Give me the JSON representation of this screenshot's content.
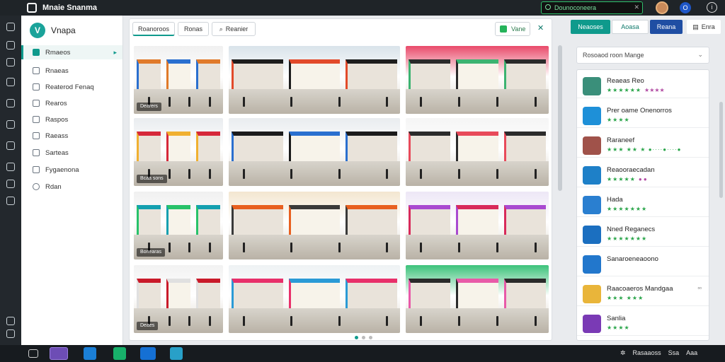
{
  "window": {
    "title": "Mnaie Snanma"
  },
  "titlebar": {
    "search_text": "Dounoconeera",
    "account_letter": "O",
    "info_glyph": "i"
  },
  "sidebar": {
    "brand": "Vnapa",
    "items": [
      {
        "label": "Rmaeos",
        "active": true
      },
      {
        "label": "Rnaeas"
      },
      {
        "label": "Reaterod Fenaq"
      },
      {
        "label": "Rearos"
      },
      {
        "label": "Raspos"
      },
      {
        "label": "Raeass"
      },
      {
        "label": "Sarteas"
      },
      {
        "label": "Fygaenona"
      },
      {
        "label": "Rdan"
      }
    ]
  },
  "main": {
    "tabs": [
      {
        "label": "Roanoroos",
        "active": true
      },
      {
        "label": "Ronas"
      },
      {
        "label": "Reanier"
      }
    ],
    "action_label": "Vane",
    "tile_captions": [
      "Dearers",
      "Bcaa sons",
      "Bonearas",
      "Deaes"
    ]
  },
  "right": {
    "tabs": [
      {
        "label": "Neaoses",
        "bg": "#0f9a8c",
        "color": "#ffffff"
      },
      {
        "label": "Aoasa",
        "bg": "#ffffff",
        "color": "#0f7a6c"
      },
      {
        "label": "Reana",
        "bg": "#1f4ea3",
        "color": "#ffffff"
      },
      {
        "label": "Enra",
        "bg": "#ffffff",
        "color": "#333333"
      }
    ],
    "dropdown": "Rosoaod roon Mange",
    "list": [
      {
        "name": "Reaeas Reo",
        "stars": "★★★★★★",
        "meta": "★★★★",
        "thumb": "#3a8f7a"
      },
      {
        "name": "Prer oame Onenorros",
        "stars": "★★★★",
        "meta": "",
        "thumb": "#1e90d8"
      },
      {
        "name": "Raraneef",
        "stars": "★★★ ★★ ★ ●····●····●",
        "meta": "",
        "thumb": "#a0524a"
      },
      {
        "name": "Reaooraecadan",
        "stars": "★★★★★",
        "meta": "● ●",
        "thumb": "#1e80c8"
      },
      {
        "name": "Hada",
        "stars": "★★★★★★★",
        "meta": "",
        "thumb": "#2a7fd0"
      },
      {
        "name": "Nned Reganecs",
        "stars": "★★★★★★★",
        "meta": "",
        "thumb": "#1b6fc0"
      },
      {
        "name": "Sanaroeneaoono",
        "stars": "",
        "meta": "",
        "thumb": "#2277cc"
      },
      {
        "name": "Raacoaeros Mandgaa",
        "stars": "★★★ ★★★",
        "meta": "",
        "thumb": "#e9b53a",
        "end": "▫▫"
      },
      {
        "name": "Sanlia",
        "stars": "★★★★",
        "meta": "",
        "thumb": "#7a3ab5"
      }
    ]
  },
  "taskbar": {
    "tray_text": "Rasaaoss",
    "tray_short": "Ssa",
    "tray_time": "Aaa"
  }
}
